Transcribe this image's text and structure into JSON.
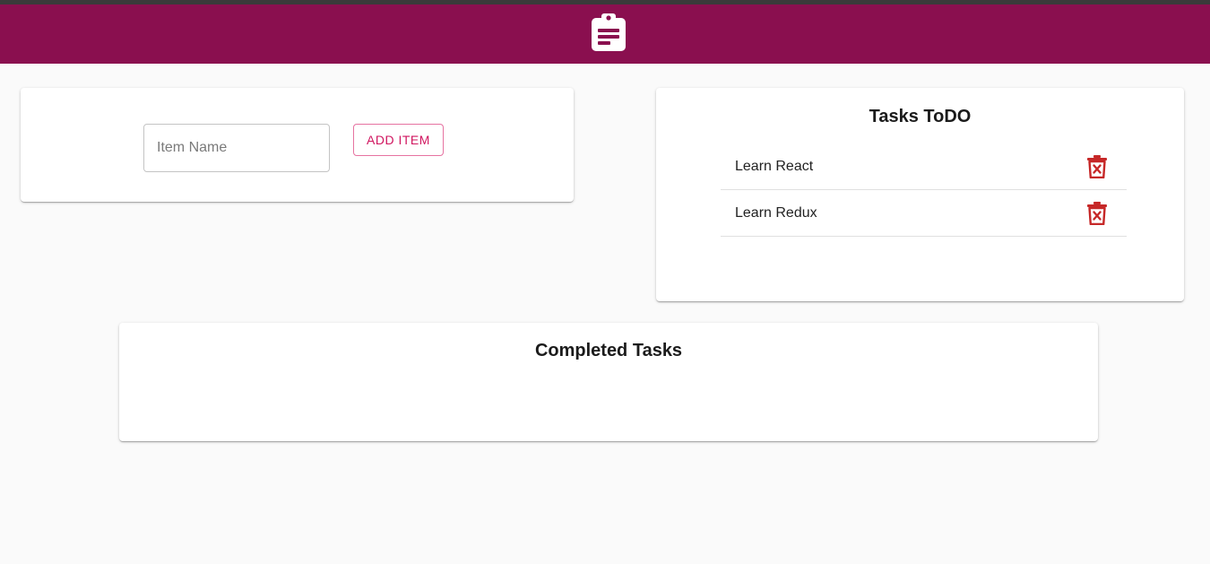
{
  "app_bar": {
    "logo_icon": "clipboard-list-icon",
    "background_color": "#8a0f4f"
  },
  "add_form": {
    "input_placeholder": "Item Name",
    "input_value": "",
    "add_button_label": "ADD ITEM",
    "accent_color": "#d0155f"
  },
  "todo": {
    "title": "Tasks ToDO",
    "items": [
      {
        "label": "Learn React",
        "delete_icon": "trash-x-icon"
      },
      {
        "label": "Learn Redux",
        "delete_icon": "trash-x-icon"
      }
    ],
    "delete_icon_color": "#c62828"
  },
  "completed": {
    "title": "Completed Tasks",
    "items": []
  }
}
